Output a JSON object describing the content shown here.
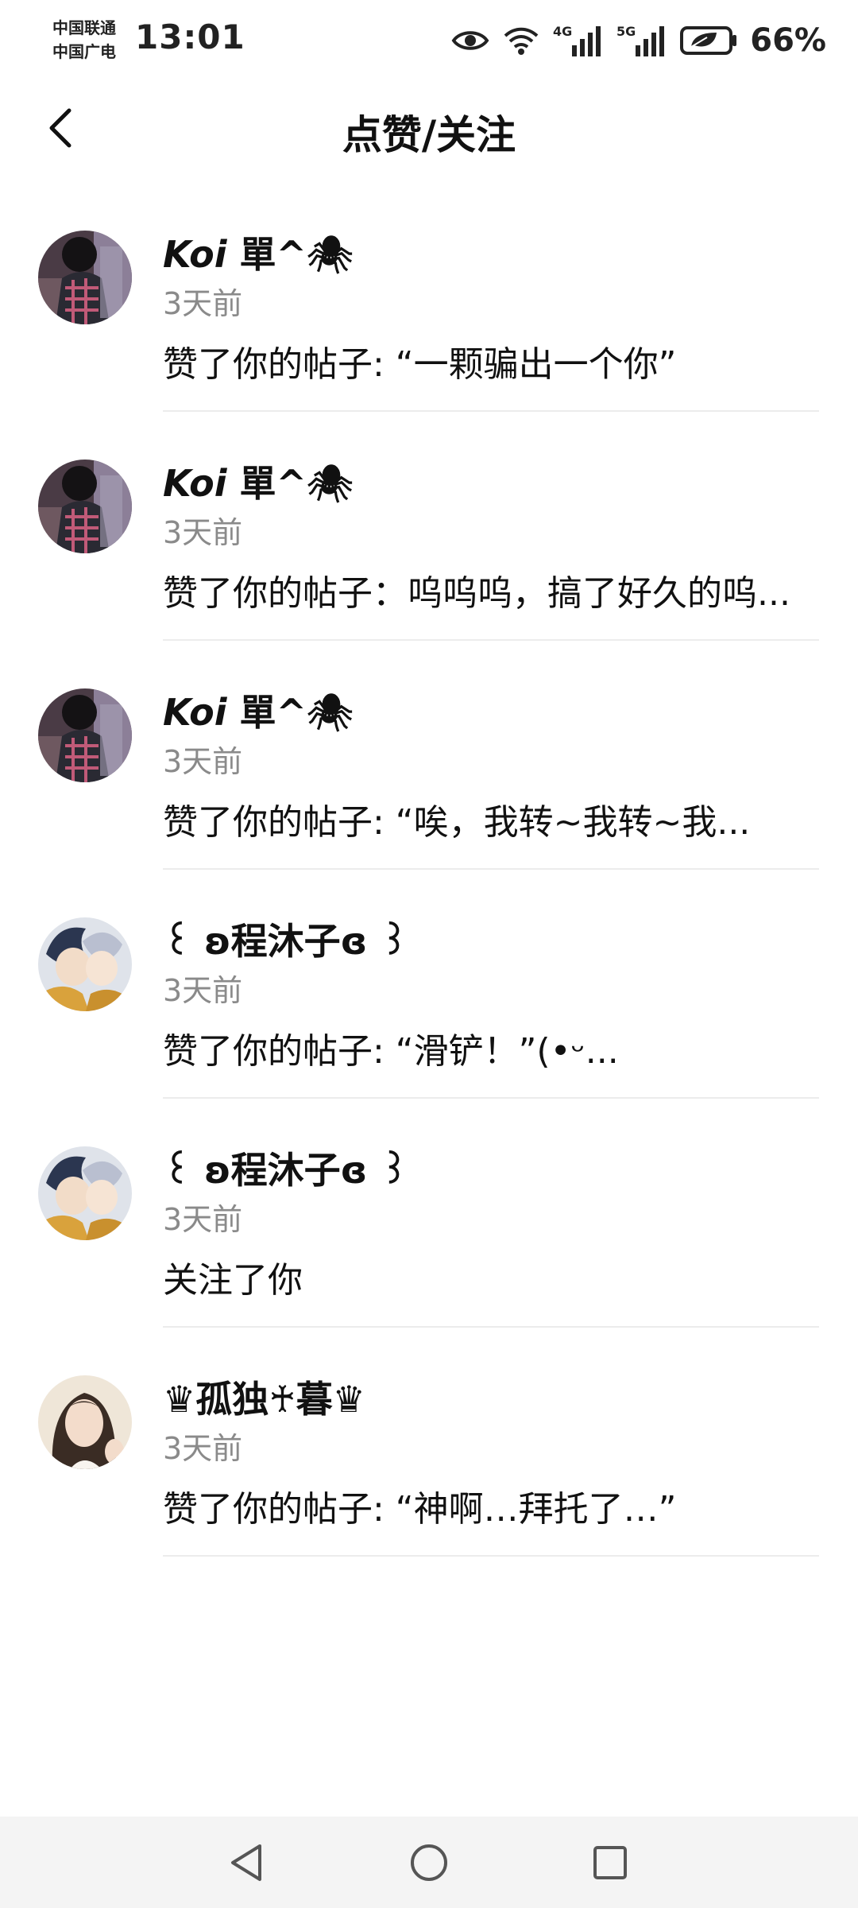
{
  "status_bar": {
    "carrier_1": "中国联通",
    "carrier_2": "中国广电",
    "time": "13:01",
    "network_1": "4G",
    "network_2": "5G",
    "battery": "66%",
    "icons": [
      "eye-icon",
      "wifi-icon",
      "signal-4g-icon",
      "signal-5g-icon",
      "battery-leaf-icon"
    ]
  },
  "header": {
    "title": "点赞/关注",
    "back_icon": "chevron-left-icon"
  },
  "notifications": [
    {
      "name_latin": "Koi",
      "name_rest": " 單^🕷",
      "time": "3天前",
      "message": "赞了你的帖子: “一颗骗出一个你”",
      "avatar": "koi"
    },
    {
      "name_latin": "Koi",
      "name_rest": " 單^🕷",
      "time": "3天前",
      "message": "赞了你的帖子：呜呜呜，搞了好久的呜...",
      "avatar": "koi"
    },
    {
      "name_latin": "Koi",
      "name_rest": " 單^🕷",
      "time": "3天前",
      "message": "赞了你的帖子: “唉，我转~我转~我...",
      "avatar": "koi"
    },
    {
      "name_latin": "",
      "name_rest": "꒰ ʚ程沐子ɞ ꒱",
      "time": "3天前",
      "message": "赞了你的帖子: “滑铲！”(•ᵕ...",
      "avatar": "anime"
    },
    {
      "name_latin": "",
      "name_rest": "꒰ ʚ程沐子ɞ ꒱",
      "time": "3天前",
      "message": "关注了你",
      "avatar": "anime"
    },
    {
      "name_latin": "",
      "name_rest": "♛孤独♰暮♛",
      "time": "3天前",
      "message": "赞了你的帖子: “神啊…拜托了…”",
      "avatar": "girl"
    }
  ],
  "nav_bar": {
    "icons": [
      "back-triangle-icon",
      "home-circle-icon",
      "recents-square-icon"
    ]
  }
}
